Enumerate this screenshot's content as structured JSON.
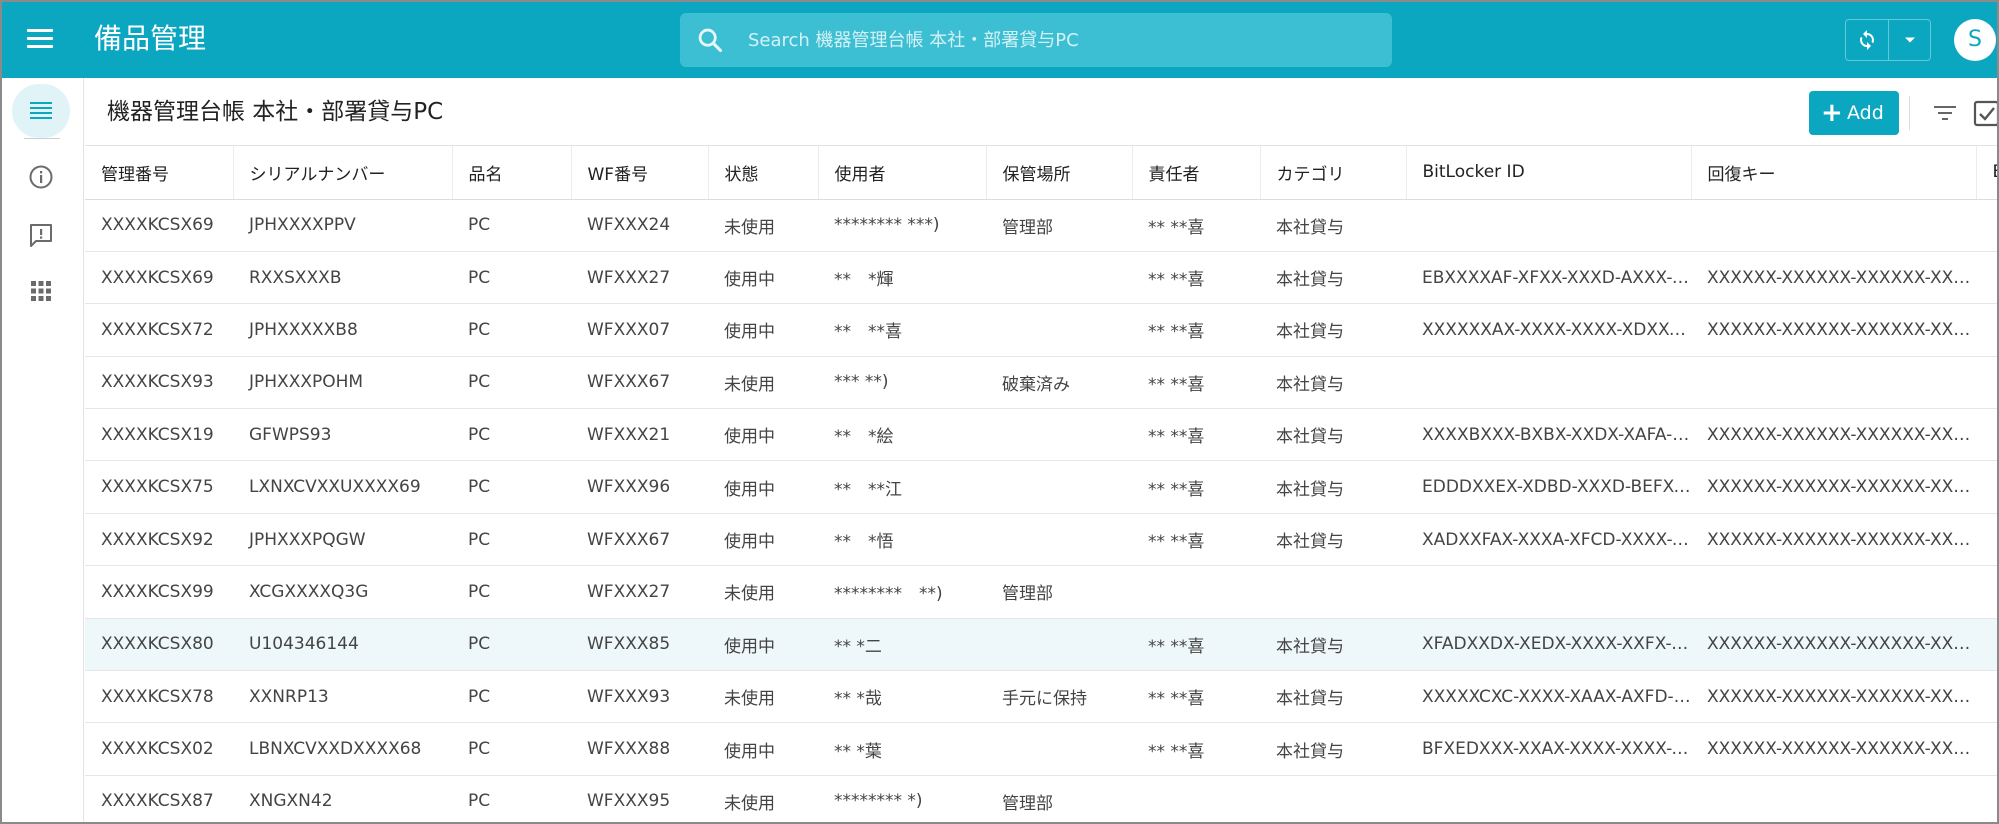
{
  "app": {
    "title": "備品管理"
  },
  "search": {
    "placeholder": "Search 機器管理台帳 本社・部署貸与PC"
  },
  "user": {
    "initial": "S"
  },
  "page": {
    "title": "機器管理台帳 本社・部署貸与PC"
  },
  "toolbar": {
    "add_label": "Add",
    "add_icon": "+"
  },
  "sidebar": {
    "items": [
      {
        "name": "list-icon",
        "active": true
      },
      {
        "name": "info-icon",
        "active": false
      },
      {
        "name": "feedback-icon",
        "active": false
      },
      {
        "name": "apps-grid-icon",
        "active": false
      }
    ]
  },
  "colors": {
    "primary": "#0ba6c0",
    "selected_row": "#eef8fa"
  },
  "table": {
    "columns": [
      "管理番号",
      "シリアルナンバー",
      "品名",
      "WF番号",
      "状態",
      "使用者",
      "保管場所",
      "責任者",
      "カテゴリ",
      "BitLocker ID",
      "回復キー",
      "B"
    ],
    "rows": [
      [
        "XXXXKCSX69",
        "JPHXXXXPPV",
        "PC",
        "WFXXX24",
        "未使用",
        "******** ***)",
        "管理部",
        "** **喜",
        "本社貸与",
        "",
        "",
        ""
      ],
      [
        "XXXXKCSX69",
        "RXXSXXXB",
        "PC",
        "WFXXX27",
        "使用中",
        "**　*輝",
        "",
        "** **喜",
        "本社貸与",
        "EBXXXXAF-XFXX-XXXD-AXXX-B…",
        "XXXXXX-XXXXXX-XXXXXX-XXX…",
        ""
      ],
      [
        "XXXXKCSX72",
        "JPHXXXXXB8",
        "PC",
        "WFXXX07",
        "使用中",
        "**　**喜",
        "",
        "** **喜",
        "本社貸与",
        "XXXXXXAX-XXXX-XXXX-XDXX-…",
        "XXXXXX-XXXXXX-XXXXXX-XXX…",
        ""
      ],
      [
        "XXXXKCSX93",
        "JPHXXXPOHM",
        "PC",
        "WFXXX67",
        "未使用",
        "*** **)",
        "破棄済み",
        "** **喜",
        "本社貸与",
        "",
        "",
        ""
      ],
      [
        "XXXXKCSX19",
        "GFWPS93",
        "PC",
        "WFXXX21",
        "使用中",
        "**　*絵",
        "",
        "** **喜",
        "本社貸与",
        "XXXXBXXX-BXBX-XXDX-XAFA-E…",
        "XXXXXX-XXXXXX-XXXXXX-XXX…",
        ""
      ],
      [
        "XXXXKCSX75",
        "LXNXCVXXUXXXX69",
        "PC",
        "WFXXX96",
        "使用中",
        "**　**江",
        "",
        "** **喜",
        "本社貸与",
        "EDDDXXEX-XDBD-XXXD-BEFX-X…",
        "XXXXXX-XXXXXX-XXXXXX-XXX…",
        ""
      ],
      [
        "XXXXKCSX92",
        "JPHXXXPQGW",
        "PC",
        "WFXXX67",
        "使用中",
        "**　*悟",
        "",
        "** **喜",
        "本社貸与",
        "XADXXFAX-XXXA-XFCD-XXXX-X…",
        "XXXXXX-XXXXXX-XXXXXX-XXX…",
        ""
      ],
      [
        "XXXXKCSX99",
        "XCGXXXXQ3G",
        "PC",
        "WFXXX27",
        "未使用",
        "********　**)",
        "管理部",
        "",
        "",
        "",
        "",
        ""
      ],
      [
        "XXXXKCSX80",
        "U104346144",
        "PC",
        "WFXXX85",
        "使用中",
        "** *二",
        "",
        "** **喜",
        "本社貸与",
        "XFADXXDX-XEDX-XXXX-XXFX-A…",
        "XXXXXX-XXXXXX-XXXXXX-XXX…",
        ""
      ],
      [
        "XXXXKCSX78",
        "XXNRP13",
        "PC",
        "WFXXX93",
        "未使用",
        "** *哉",
        "手元に保持",
        "** **喜",
        "本社貸与",
        "XXXXXCXC-XXXX-XAAX-AXFD-…",
        "XXXXXX-XXXXXX-XXXXXX-XXX…",
        ""
      ],
      [
        "XXXXKCSX02",
        "LBNXCVXXDXXXX68",
        "PC",
        "WFXXX88",
        "使用中",
        "** *葉",
        "",
        "** **喜",
        "本社貸与",
        "BFXEDXXX-XXAX-XXXX-XXXX-X…",
        "XXXXXX-XXXXXX-XXXXXX-XXX…",
        ""
      ],
      [
        "XXXXKCSX87",
        "XNGXN42",
        "PC",
        "WFXXX95",
        "未使用",
        "******** *)",
        "管理部",
        "",
        "",
        "",
        "",
        ""
      ]
    ],
    "selected_row_index": 8
  }
}
